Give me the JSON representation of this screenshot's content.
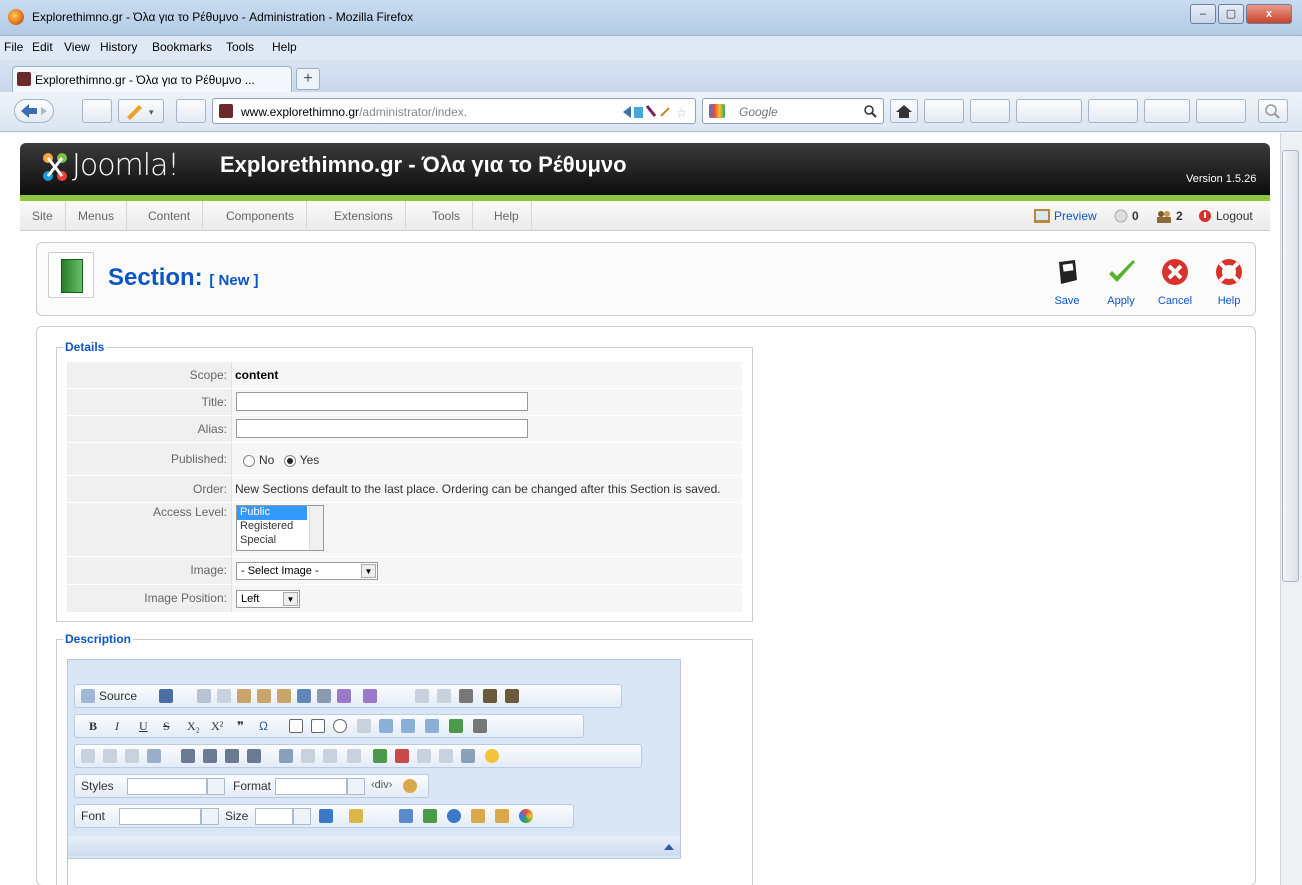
{
  "window": {
    "title": "Explorethimno.gr - Όλα για το Ρέθυμνο - Administration - Mozilla Firefox",
    "minimize": "–",
    "maximize": "▢",
    "close": "x"
  },
  "menu": {
    "file": "File",
    "edit": "Edit",
    "view": "View",
    "history": "History",
    "bookmarks": "Bookmarks",
    "tools": "Tools",
    "help": "Help"
  },
  "tab": {
    "label": "Explorethimno.gr - Όλα για το Ρέθυμνο ...",
    "new_tab": "+"
  },
  "address": {
    "host": "www.explorethimno.gr",
    "path": "/administrator/index.",
    "search_placeholder": "Google"
  },
  "joomla": {
    "logo": "Joomla!",
    "site_title": "Explorethimno.gr - Όλα για το Ρέθυμνο",
    "version": "Version 1.5.26",
    "menu": [
      "Site",
      "Menus",
      "Content",
      "Components",
      "Extensions",
      "Tools",
      "Help"
    ],
    "status": {
      "preview": "Preview",
      "messages": "0",
      "users": "2",
      "logout": "Logout"
    }
  },
  "page": {
    "title": "Section:",
    "subtitle": "[ New ]",
    "buttons": {
      "save": "Save",
      "apply": "Apply",
      "cancel": "Cancel",
      "help": "Help"
    }
  },
  "details": {
    "legend": "Details",
    "scope_label": "Scope:",
    "scope_value": "content",
    "title_label": "Title:",
    "title_value": "",
    "alias_label": "Alias:",
    "alias_value": "",
    "published_label": "Published:",
    "published_no": "No",
    "published_yes": "Yes",
    "published_selected": "Yes",
    "order_label": "Order:",
    "order_text": "New Sections default to the last place. Ordering can be changed after this Section is saved.",
    "access_label": "Access Level:",
    "access_options": [
      "Public",
      "Registered",
      "Special"
    ],
    "access_selected": "Public",
    "image_label": "Image:",
    "image_value": "- Select Image -",
    "image_position_label": "Image Position:",
    "image_position_value": "Left"
  },
  "description": {
    "legend": "Description",
    "source": "Source",
    "styles": "Styles",
    "format": "Format",
    "font": "Font",
    "size": "Size"
  }
}
